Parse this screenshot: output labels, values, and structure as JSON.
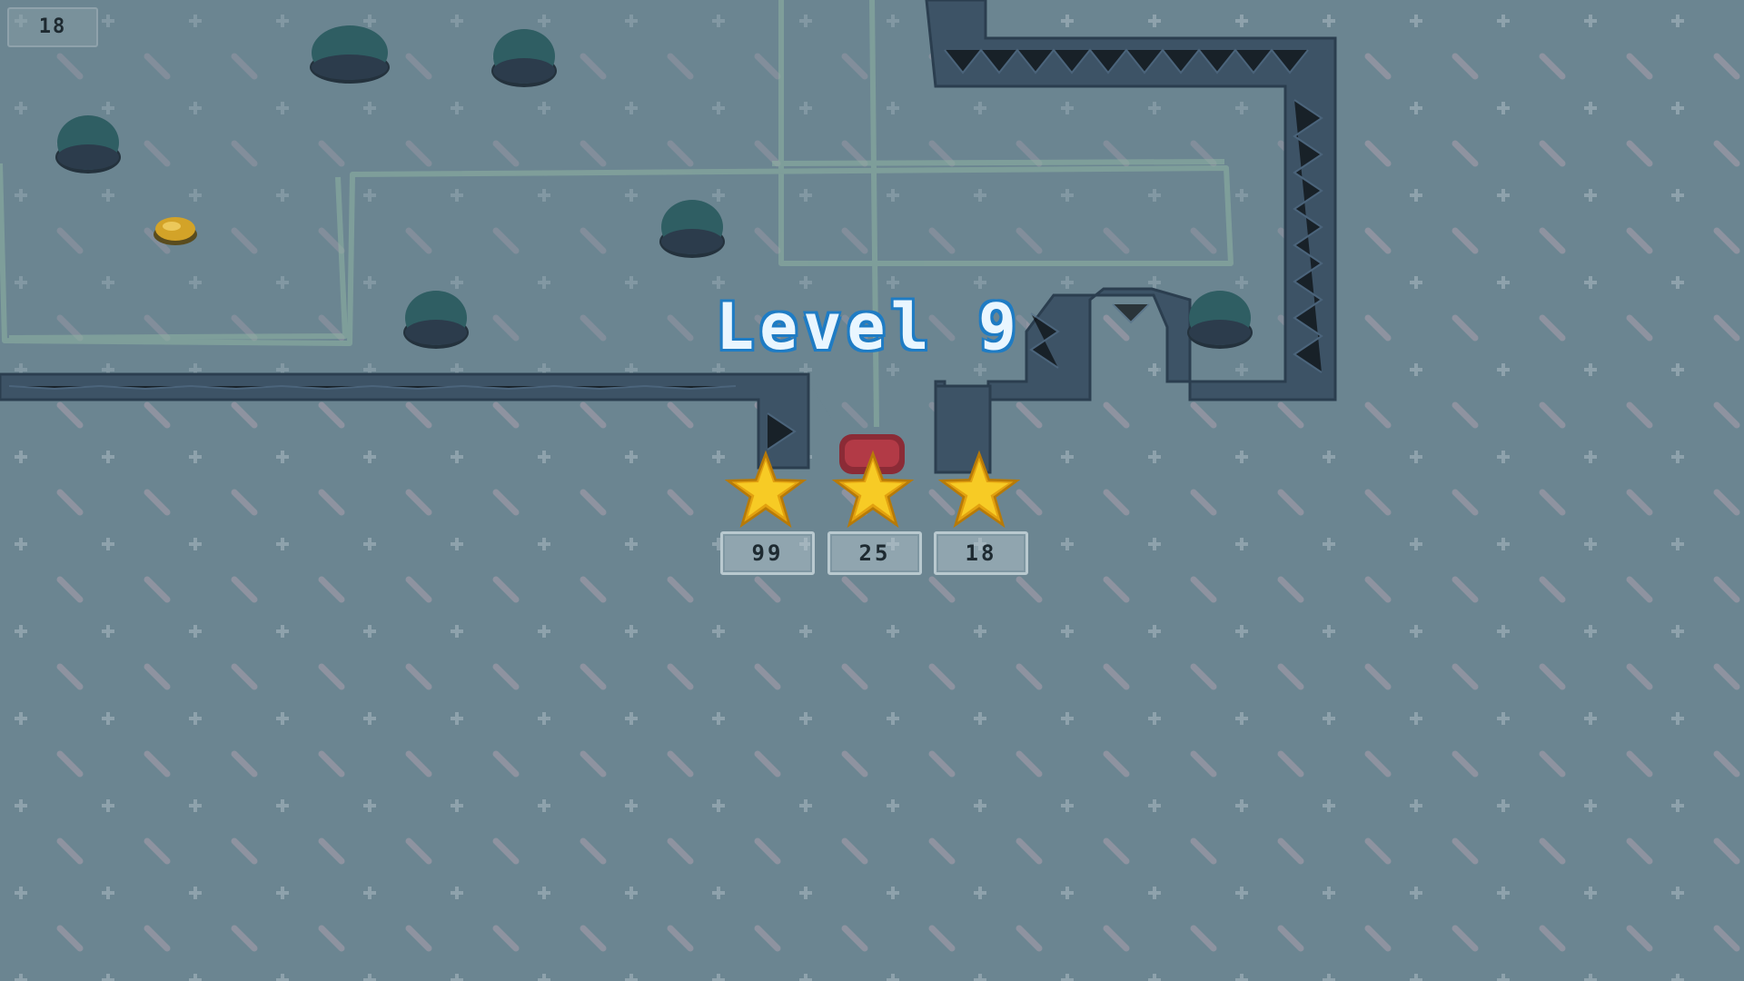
{
  "hud": {
    "counter": "18"
  },
  "level": {
    "title": "Level 9"
  },
  "stars": [
    {
      "score": "99"
    },
    {
      "score": "25"
    },
    {
      "score": "18"
    }
  ],
  "colors": {
    "floor": "#6b8591",
    "wall": "#3d5366",
    "boulder": "#2f5e63",
    "star": "#f6c21a",
    "title_outline": "#1f7cc4"
  },
  "icons": [
    "boulder-icon",
    "gold-gem-icon",
    "star-icon",
    "player-icon"
  ]
}
